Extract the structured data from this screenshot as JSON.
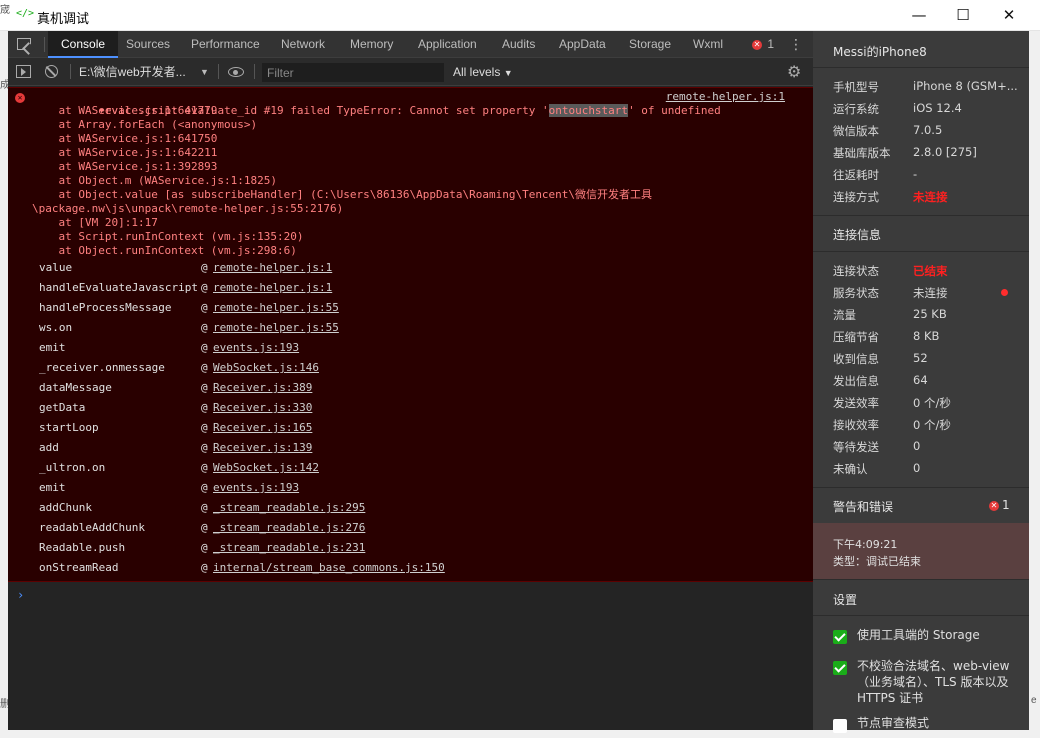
{
  "window": {
    "title": "真机调试",
    "icon_text": "</>",
    "minimize": "—",
    "maximize": "☐",
    "close": "✕"
  },
  "edges": {
    "left_glyph_1": "宬",
    "left_glyph_2": "成",
    "left_glyph_3": "删",
    "right_glyph_1": "e"
  },
  "tabs": [
    {
      "label": "Console",
      "active": true
    },
    {
      "label": "Sources"
    },
    {
      "label": "Performance"
    },
    {
      "label": "Network"
    },
    {
      "label": "Memory"
    },
    {
      "label": "Application"
    },
    {
      "label": "Audits"
    },
    {
      "label": "AppData"
    },
    {
      "label": "Storage"
    },
    {
      "label": "Wxml"
    }
  ],
  "error_badge_count": "1",
  "toolbar": {
    "context": "E:\\微信web开发者...",
    "filter_placeholder": "Filter",
    "levels": "All levels"
  },
  "error": {
    "message_prefix": "eval script evaluate_id #19 failed TypeError: Cannot set property '",
    "message_highlight": "ontouchstart",
    "message_suffix": "' of undefined",
    "source": "remote-helper.js:1",
    "stack": [
      "    at WAService.js:1:641779",
      "    at Array.forEach (<anonymous>)",
      "    at WAService.js:1:641750",
      "    at WAService.js:1:642211",
      "    at WAService.js:1:392893",
      "    at Object.m (WAService.js:1:1825)",
      "    at Object.value [as subscribeHandler] (C:\\Users\\86136\\AppData\\Roaming\\Tencent\\微信开发者工具",
      "\\package.nw\\js\\unpack\\remote-helper.js:55:2176)",
      "    at [VM 20]:1:17",
      "    at Script.runInContext (vm.js:135:20)",
      "    at Object.runInContext (vm.js:298:6)"
    ],
    "frames": [
      {
        "fn": "value",
        "src": "remote-helper.js:1"
      },
      {
        "fn": "handleEvaluateJavascript",
        "src": "remote-helper.js:1"
      },
      {
        "fn": "handleProcessMessage",
        "src": "remote-helper.js:55"
      },
      {
        "fn": "ws.on",
        "src": "remote-helper.js:55"
      },
      {
        "fn": "emit",
        "src": "events.js:193"
      },
      {
        "fn": "_receiver.onmessage",
        "src": "WebSocket.js:146"
      },
      {
        "fn": "dataMessage",
        "src": "Receiver.js:389"
      },
      {
        "fn": "getData",
        "src": "Receiver.js:330"
      },
      {
        "fn": "startLoop",
        "src": "Receiver.js:165"
      },
      {
        "fn": "add",
        "src": "Receiver.js:139"
      },
      {
        "fn": "_ultron.on",
        "src": "WebSocket.js:142"
      },
      {
        "fn": "emit",
        "src": "events.js:193"
      },
      {
        "fn": "addChunk",
        "src": "_stream_readable.js:295"
      },
      {
        "fn": "readableAddChunk",
        "src": "_stream_readable.js:276"
      },
      {
        "fn": "Readable.push",
        "src": "_stream_readable.js:231"
      },
      {
        "fn": "onStreamRead",
        "src": "internal/stream_base_commons.js:150"
      }
    ],
    "at_symbol": "@"
  },
  "prompt": "›",
  "panel": {
    "device_title": "Messi的iPhone8",
    "device_info": [
      {
        "k": "手机型号",
        "v": "iPhone 8 (GSM+..."
      },
      {
        "k": "运行系统",
        "v": "iOS 12.4"
      },
      {
        "k": "微信版本",
        "v": "7.0.5"
      },
      {
        "k": "基础库版本",
        "v": "2.8.0 [275]"
      },
      {
        "k": "往返耗时",
        "v": "-"
      },
      {
        "k": "连接方式",
        "v": "未连接",
        "red": true
      }
    ],
    "conn_title": "连接信息",
    "conn_info": [
      {
        "k": "连接状态",
        "v": "已结束",
        "red": true
      },
      {
        "k": "服务状态",
        "v": "未连接",
        "dot": true
      },
      {
        "k": "流量",
        "v": "25 KB"
      },
      {
        "k": "压缩节省",
        "v": "8 KB"
      },
      {
        "k": "收到信息",
        "v": "52"
      },
      {
        "k": "发出信息",
        "v": "64"
      },
      {
        "k": "发送效率",
        "v": "0 个/秒"
      },
      {
        "k": "接收效率",
        "v": "0 个/秒"
      },
      {
        "k": "等待发送",
        "v": "0"
      },
      {
        "k": "未确认",
        "v": "0"
      }
    ],
    "warn_title": "警告和错误",
    "warn_count": "1",
    "alert_time": "下午4:09:21",
    "alert_type": "类型：调试已结束",
    "settings_title": "设置",
    "settings": [
      {
        "label": "使用工具端的 Storage",
        "checked": true
      },
      {
        "label": "不校验合法域名、web-view（业务域名）、TLS 版本以及 HTTPS 证书",
        "checked": true
      },
      {
        "label": "节点审查模式",
        "checked": false
      }
    ]
  },
  "colors": {
    "error_bg": "#290000",
    "error_text": "#ff8080",
    "accent_green": "#1aad19",
    "status_red": "#ff2020"
  }
}
